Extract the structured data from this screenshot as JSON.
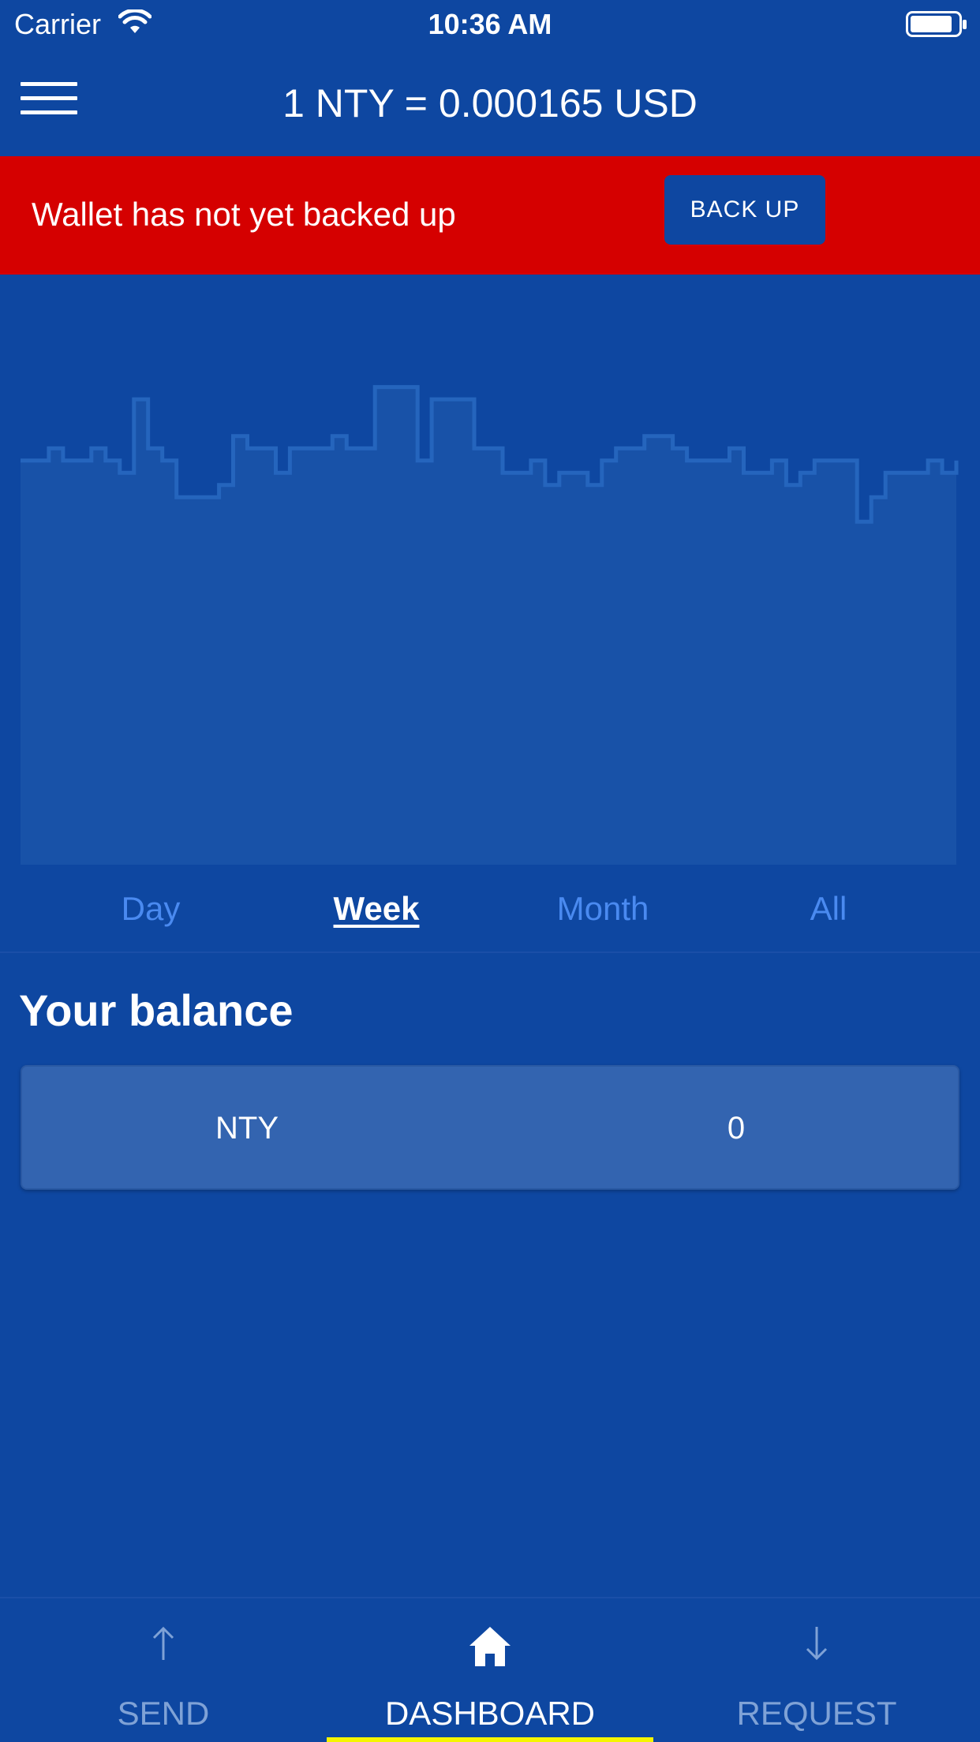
{
  "status_bar": {
    "carrier": "Carrier",
    "time": "10:36 AM"
  },
  "header": {
    "rate_title": "1 NTY = 0.000165 USD",
    "menu_icon": "hamburger-menu-icon"
  },
  "backup_banner": {
    "message": "Wallet has not yet backed up",
    "button_label": "BACK UP"
  },
  "chart_data": {
    "type": "area",
    "title": "",
    "xlabel": "",
    "ylabel": "",
    "series": [
      {
        "values": [
          0.000163,
          0.000163,
          0.000164,
          0.000163,
          0.000163,
          0.000164,
          0.000163,
          0.000162,
          0.000168,
          0.000164,
          0.000163,
          0.00016,
          0.00016,
          0.00016,
          0.000161,
          0.000165,
          0.000164,
          0.000164,
          0.000162,
          0.000164,
          0.000164,
          0.000164,
          0.000165,
          0.000164,
          0.000164,
          0.000169,
          0.000169,
          0.000169,
          0.000163,
          0.000168,
          0.000168,
          0.000168,
          0.000164,
          0.000164,
          0.000162,
          0.000162,
          0.000163,
          0.000161,
          0.000162,
          0.000162,
          0.000161,
          0.000163,
          0.000164,
          0.000164,
          0.000165,
          0.000165,
          0.000164,
          0.000163,
          0.000163,
          0.000163,
          0.000164,
          0.000162,
          0.000162,
          0.000163,
          0.000161,
          0.000162,
          0.000163,
          0.000163,
          0.000163,
          0.000158,
          0.00016,
          0.000162,
          0.000162,
          0.000162,
          0.000163,
          0.000162,
          0.000163
        ]
      }
    ],
    "periods": [
      "Day",
      "Week",
      "Month",
      "All"
    ],
    "selected_period": "Week",
    "colors": {
      "line": "#2565bd",
      "fill": "#1852a8"
    }
  },
  "balance": {
    "title": "Your balance",
    "currency": "NTY",
    "amount": "0"
  },
  "bottom_nav": {
    "items": [
      {
        "label": "SEND",
        "icon": "arrow-up-icon",
        "active": false
      },
      {
        "label": "DASHBOARD",
        "icon": "home-icon",
        "active": true
      },
      {
        "label": "REQUEST",
        "icon": "arrow-down-icon",
        "active": false
      }
    ],
    "indicator_color": "#f5f500"
  },
  "colors": {
    "background": "#0e47a1",
    "banner": "#d50000",
    "card": "#3364b0",
    "tab_inactive": "#4a8af0"
  }
}
